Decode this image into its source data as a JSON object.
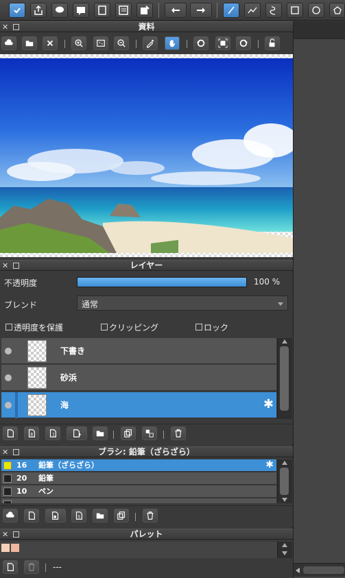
{
  "toolbar": {
    "tools": [
      "save-cloud-icon",
      "share-icon",
      "speech-icon",
      "comment-icon",
      "page-icon",
      "list-icon",
      "checklist-icon"
    ],
    "undo": "undo-icon",
    "redo": "redo-icon",
    "draw": [
      "line-icon",
      "polyline-icon",
      "curve-icon",
      "rect-icon",
      "circle-icon",
      "polygon-icon"
    ]
  },
  "reference": {
    "title": "資料",
    "tools": [
      "cloud-open-icon",
      "folder-icon",
      "close-icon",
      "zoom-in-icon",
      "fit-icon",
      "zoom-out-icon",
      "eyedropper-icon",
      "hand-icon",
      "rotate-left-icon",
      "center-icon",
      "rotate-right-icon",
      "lock-icon"
    ]
  },
  "layer": {
    "title": "レイヤー",
    "opacity_label": "不透明度",
    "opacity_value": "100 %",
    "opacity": 1.0,
    "blend_label": "ブレンド",
    "blend_value": "通常",
    "protect_label": "透明度を保護",
    "clipping_label": "クリッピング",
    "lock_label": "ロック",
    "items": [
      {
        "name": "下書き"
      },
      {
        "name": "砂浜"
      },
      {
        "name": "海"
      }
    ]
  },
  "brush": {
    "title": "ブラシ: 鉛筆（ざらざら）",
    "items": [
      {
        "size": "16",
        "name": "鉛筆（ざらざら）"
      },
      {
        "size": "20",
        "name": "鉛筆"
      },
      {
        "size": "10",
        "name": "ペン"
      }
    ]
  },
  "palette": {
    "title": "パレット",
    "value": "---",
    "colors": [
      "#f5d0b8",
      "#f0b8a0"
    ]
  },
  "colors": {
    "accent": "#3d8fd6",
    "sel_swatch": "#e6e600"
  }
}
